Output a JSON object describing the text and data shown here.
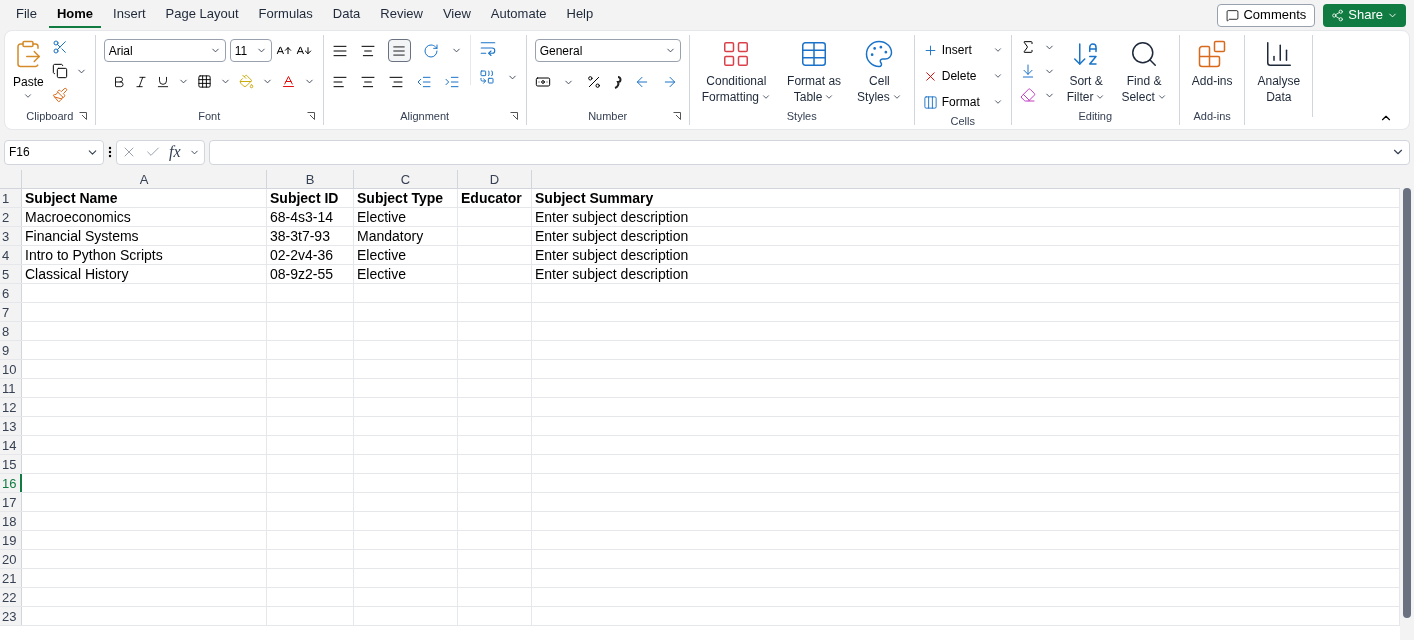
{
  "menu_tabs": [
    {
      "label": "File",
      "selected": false
    },
    {
      "label": "Home",
      "selected": true
    },
    {
      "label": "Insert",
      "selected": false
    },
    {
      "label": "Page Layout",
      "selected": false
    },
    {
      "label": "Formulas",
      "selected": false
    },
    {
      "label": "Data",
      "selected": false
    },
    {
      "label": "Review",
      "selected": false
    },
    {
      "label": "View",
      "selected": false
    },
    {
      "label": "Automate",
      "selected": false
    },
    {
      "label": "Help",
      "selected": false
    }
  ],
  "top_buttons": {
    "comments": "Comments",
    "share": "Share"
  },
  "ribbon": {
    "clipboard": {
      "paste": "Paste",
      "label": "Clipboard"
    },
    "font": {
      "name": "Arial",
      "size": "11",
      "label": "Font"
    },
    "alignment": {
      "label": "Alignment"
    },
    "number": {
      "format": "General",
      "label": "Number"
    },
    "styles": {
      "label": "Styles",
      "buttons": [
        [
          "Conditional",
          "Formatting"
        ],
        [
          "Format as",
          "Table"
        ],
        [
          "Cell",
          "Styles"
        ]
      ]
    },
    "cells": {
      "label": "Cells",
      "buttons": [
        "Insert",
        "Delete",
        "Format"
      ]
    },
    "editing": {
      "label": "Editing",
      "buttons": [
        [
          "Sort &",
          "Filter"
        ],
        [
          "Find &",
          "Select"
        ]
      ]
    },
    "addins": {
      "label": "Add-ins",
      "button": "Add-ins"
    },
    "analyse": {
      "button": [
        "Analyse",
        "Data"
      ]
    }
  },
  "formula_bar": {
    "name_box": "F16",
    "function_label": "fx"
  },
  "sheet": {
    "columns": [
      "A",
      "B",
      "C",
      "D"
    ],
    "header_cells": [
      "Subject Name",
      "Subject ID",
      "Subject Type",
      "Educator",
      "Subject Summary"
    ],
    "rows": [
      {
        "number": "2",
        "selected": false,
        "cells": [
          "Macroeconomics",
          "68-4s3-14",
          "Elective",
          null,
          "Enter subject description"
        ]
      },
      {
        "number": "3",
        "selected": false,
        "cells": [
          "Financial Systems",
          "38-3t7-93",
          "Mandatory",
          null,
          "Enter subject description"
        ]
      },
      {
        "number": "4",
        "selected": false,
        "cells": [
          "Intro to Python Scripts",
          "02-2v4-36",
          "Elective",
          null,
          "Enter subject description"
        ]
      },
      {
        "number": "5",
        "selected": false,
        "cells": [
          "Classical History",
          "08-9z2-55",
          "Elective",
          null,
          "Enter subject description"
        ]
      },
      {
        "number": "6",
        "selected": false,
        "cells": []
      },
      {
        "number": "7",
        "selected": false,
        "cells": []
      },
      {
        "number": "8",
        "selected": false,
        "cells": []
      },
      {
        "number": "9",
        "selected": false,
        "cells": []
      },
      {
        "number": "10",
        "selected": false,
        "cells": []
      },
      {
        "number": "11",
        "selected": false,
        "cells": []
      },
      {
        "number": "12",
        "selected": false,
        "cells": []
      },
      {
        "number": "13",
        "selected": false,
        "cells": []
      },
      {
        "number": "14",
        "selected": false,
        "cells": []
      },
      {
        "number": "15",
        "selected": false,
        "cells": []
      },
      {
        "number": "16",
        "selected": true,
        "cells": []
      },
      {
        "number": "17",
        "selected": false,
        "cells": []
      },
      {
        "number": "18",
        "selected": false,
        "cells": []
      },
      {
        "number": "19",
        "selected": false,
        "cells": []
      },
      {
        "number": "20",
        "selected": false,
        "cells": []
      },
      {
        "number": "21",
        "selected": false,
        "cells": []
      },
      {
        "number": "22",
        "selected": false,
        "cells": []
      },
      {
        "number": "23",
        "selected": false,
        "cells": []
      }
    ],
    "header_row_number": "1"
  }
}
